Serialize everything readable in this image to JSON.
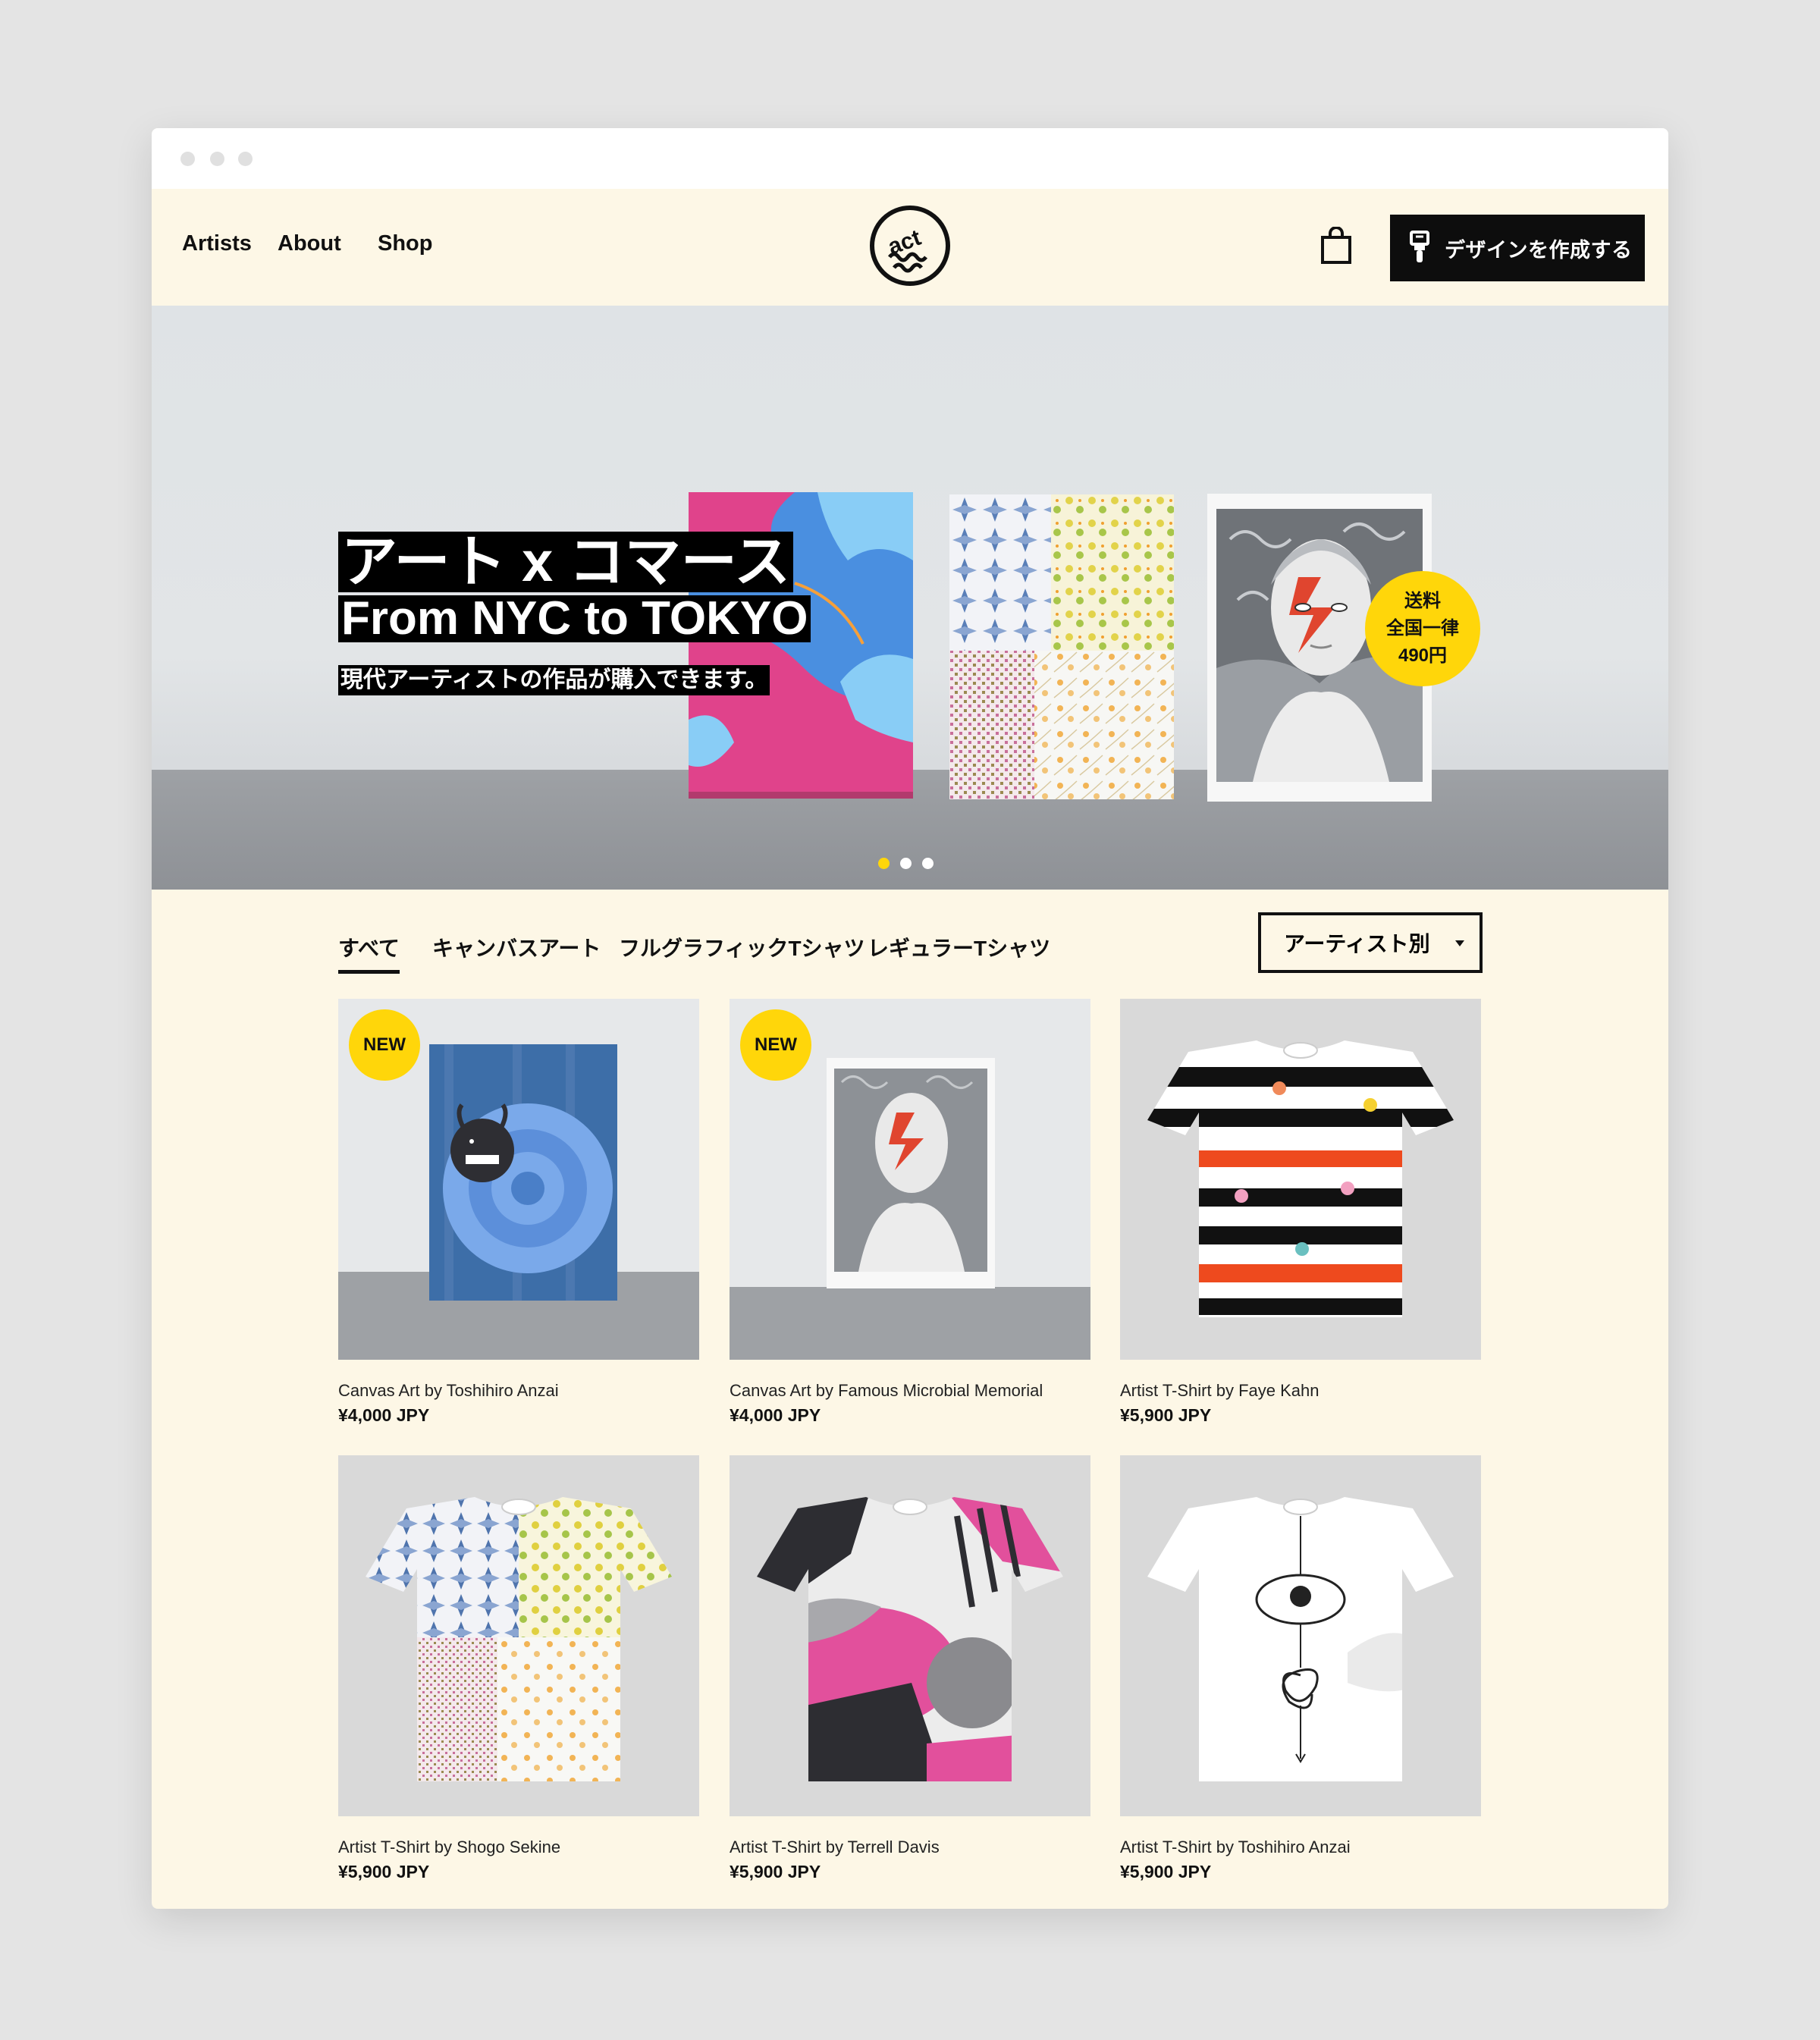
{
  "nav": {
    "artists": "Artists",
    "about": "About",
    "shop": "Shop"
  },
  "logo": {
    "text": "act"
  },
  "cta": {
    "label": "デザインを作成する"
  },
  "hero": {
    "title": "アート x コマース",
    "title2": "From NYC to TOKYO",
    "subtitle": "現代アーティストの作品が購入できます。",
    "badge": {
      "line1": "送料",
      "line2": "全国一律",
      "line3": "490円"
    },
    "slides": 3,
    "active_slide": 1
  },
  "tabs": [
    {
      "label": "すべて",
      "active": true
    },
    {
      "label": "キャンバスアート",
      "active": false
    },
    {
      "label": "フルグラフィックTシャツ",
      "active": false
    },
    {
      "label": "レギュラーTシャツ",
      "active": false
    }
  ],
  "filter": {
    "label": "アーティスト別"
  },
  "products": [
    {
      "name": "Canvas Art by Toshihiro Anzai",
      "price": "¥4,000 JPY",
      "badge": "NEW"
    },
    {
      "name": "Canvas Art by Famous Microbial Memorial",
      "price": "¥4,000 JPY",
      "badge": "NEW"
    },
    {
      "name": "Artist T-Shirt by Faye Kahn",
      "price": "¥5,900 JPY"
    },
    {
      "name": "Artist T-Shirt by Shogo Sekine",
      "price": "¥5,900 JPY"
    },
    {
      "name": "Artist T-Shirt by Terrell Davis",
      "price": "¥5,900 JPY"
    },
    {
      "name": "Artist T-Shirt by Toshihiro Anzai",
      "price": "¥5,900 JPY"
    }
  ],
  "colors": {
    "accent": "#ffd60a",
    "background": "#fdf7e6",
    "dark": "#0d0d0d"
  }
}
